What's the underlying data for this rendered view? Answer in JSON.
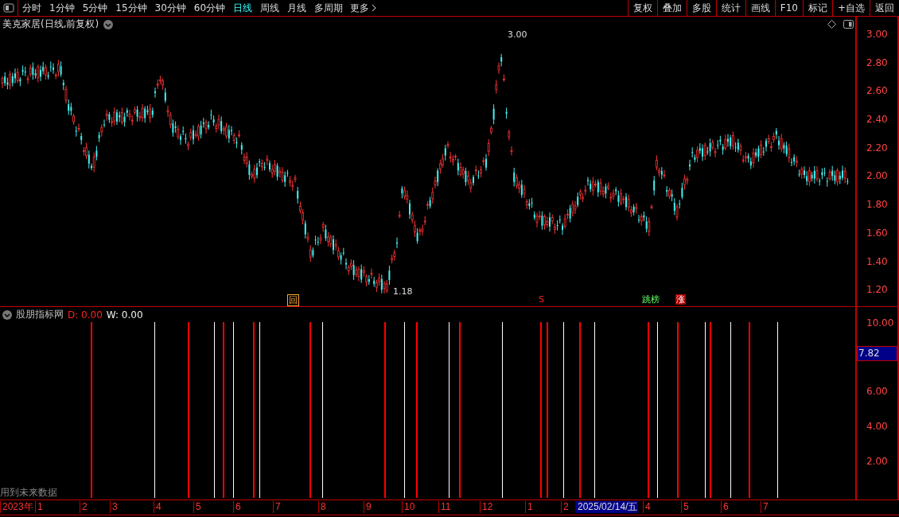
{
  "toolbar": {
    "periods": [
      {
        "label": "分时",
        "selected": false
      },
      {
        "label": "1分钟",
        "selected": false
      },
      {
        "label": "5分钟",
        "selected": false
      },
      {
        "label": "15分钟",
        "selected": false
      },
      {
        "label": "30分钟",
        "selected": false
      },
      {
        "label": "60分钟",
        "selected": false
      },
      {
        "label": "日线",
        "selected": true
      },
      {
        "label": "周线",
        "selected": false
      },
      {
        "label": "月线",
        "selected": false
      },
      {
        "label": "多周期",
        "selected": false
      }
    ],
    "more": "更多",
    "buttons": [
      "复权",
      "叠加",
      "多股",
      "统计",
      "画线",
      "F10",
      "标记",
      "+自选",
      "返回"
    ]
  },
  "price_panel": {
    "title": "美克家居(日线,前复权)",
    "axis_labels": [
      "3.00",
      "2.80",
      "2.60",
      "2.40",
      "2.20",
      "2.00",
      "1.80",
      "1.60",
      "1.40",
      "1.20"
    ],
    "price_marks": [
      {
        "label": "3.00"
      },
      {
        "label": "1.18"
      }
    ],
    "events": [
      {
        "label": "回",
        "kind": "box"
      },
      {
        "label": "S",
        "kind": "letter"
      },
      {
        "label": "跳榜",
        "kind": "dual"
      },
      {
        "label": "涨",
        "kind": "filled"
      }
    ]
  },
  "indicator_panel": {
    "title": "股朋指标网",
    "d_reading": "D: 0.00",
    "w_reading": "W: 0.00",
    "note": "用到未来数据",
    "axis_labels": [
      {
        "text": "10.00",
        "selected": false
      },
      {
        "text": "7.82",
        "selected": true
      },
      {
        "text": "6.00",
        "selected": false
      },
      {
        "text": "4.00",
        "selected": false
      },
      {
        "text": "2.00",
        "selected": false
      }
    ]
  },
  "date_axis": [
    {
      "text": "2023年",
      "selected": false
    },
    {
      "text": "1",
      "selected": false
    },
    {
      "text": "2",
      "selected": false
    },
    {
      "text": "3",
      "selected": false
    },
    {
      "text": "4",
      "selected": false
    },
    {
      "text": "5",
      "selected": false
    },
    {
      "text": "6",
      "selected": false
    },
    {
      "text": "7",
      "selected": false
    },
    {
      "text": "8",
      "selected": false
    },
    {
      "text": "9",
      "selected": false
    },
    {
      "text": "10",
      "selected": false
    },
    {
      "text": "11",
      "selected": false
    },
    {
      "text": "12",
      "selected": false
    },
    {
      "text": "1",
      "selected": false
    },
    {
      "text": "2",
      "selected": false
    },
    {
      "text": "2025/02/14/五",
      "selected": true
    },
    {
      "text": "4",
      "selected": false
    },
    {
      "text": "5",
      "selected": false
    },
    {
      "text": "6",
      "selected": false
    },
    {
      "text": "7",
      "selected": false
    }
  ]
}
